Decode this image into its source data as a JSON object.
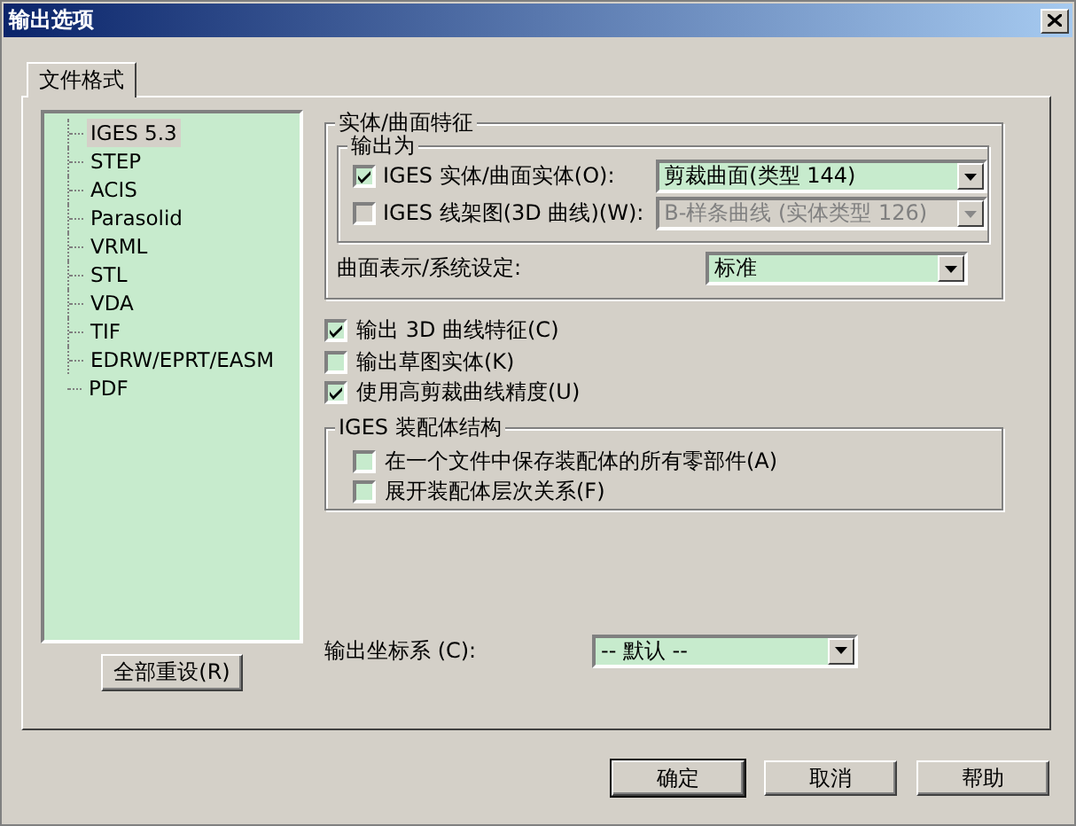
{
  "window": {
    "title": "输出选项"
  },
  "tabs": [
    {
      "label": "文件格式",
      "selected": true
    }
  ],
  "tree": {
    "items": [
      {
        "label": "IGES 5.3",
        "selected": true
      },
      {
        "label": "STEP",
        "selected": false
      },
      {
        "label": "ACIS",
        "selected": false
      },
      {
        "label": "Parasolid",
        "selected": false
      },
      {
        "label": "VRML",
        "selected": false
      },
      {
        "label": "STL",
        "selected": false
      },
      {
        "label": "VDA",
        "selected": false
      },
      {
        "label": "TIF",
        "selected": false
      },
      {
        "label": "EDRW/EPRT/EASM",
        "selected": false
      },
      {
        "label": "PDF",
        "selected": false
      }
    ]
  },
  "reset_button": "全部重设(R)",
  "solid_surface_group": {
    "title": "实体/曲面特征",
    "output_as": {
      "title": "输出为",
      "rows": [
        {
          "label": "IGES 实体/曲面实体(O):",
          "checked": true,
          "value": "剪裁曲面(类型 144)",
          "disabled": false
        },
        {
          "label": "IGES 线架图(3D 曲线)(W):",
          "checked": false,
          "value": "B-样条曲线 (实体类型 126)",
          "disabled": true
        }
      ]
    },
    "surface_display": {
      "label": "曲面表示/系统设定:",
      "value": "标准"
    }
  },
  "options": [
    {
      "label": "输出 3D 曲线特征(C)",
      "checked": true
    },
    {
      "label": "输出草图实体(K)",
      "checked": false
    },
    {
      "label": "使用高剪裁曲线精度(U)",
      "checked": true
    }
  ],
  "assembly_group": {
    "title": "IGES 装配体结构",
    "options": [
      {
        "label": "在一个文件中保存装配体的所有零部件(A)",
        "checked": false
      },
      {
        "label": "展开装配体层次关系(F)",
        "checked": false
      }
    ]
  },
  "coordinate_system": {
    "label": "输出坐标系 (C):",
    "value": "-- 默认 --"
  },
  "buttons": [
    {
      "label": "确定",
      "default": true
    },
    {
      "label": "取消",
      "default": false
    },
    {
      "label": "帮助",
      "default": false
    }
  ]
}
